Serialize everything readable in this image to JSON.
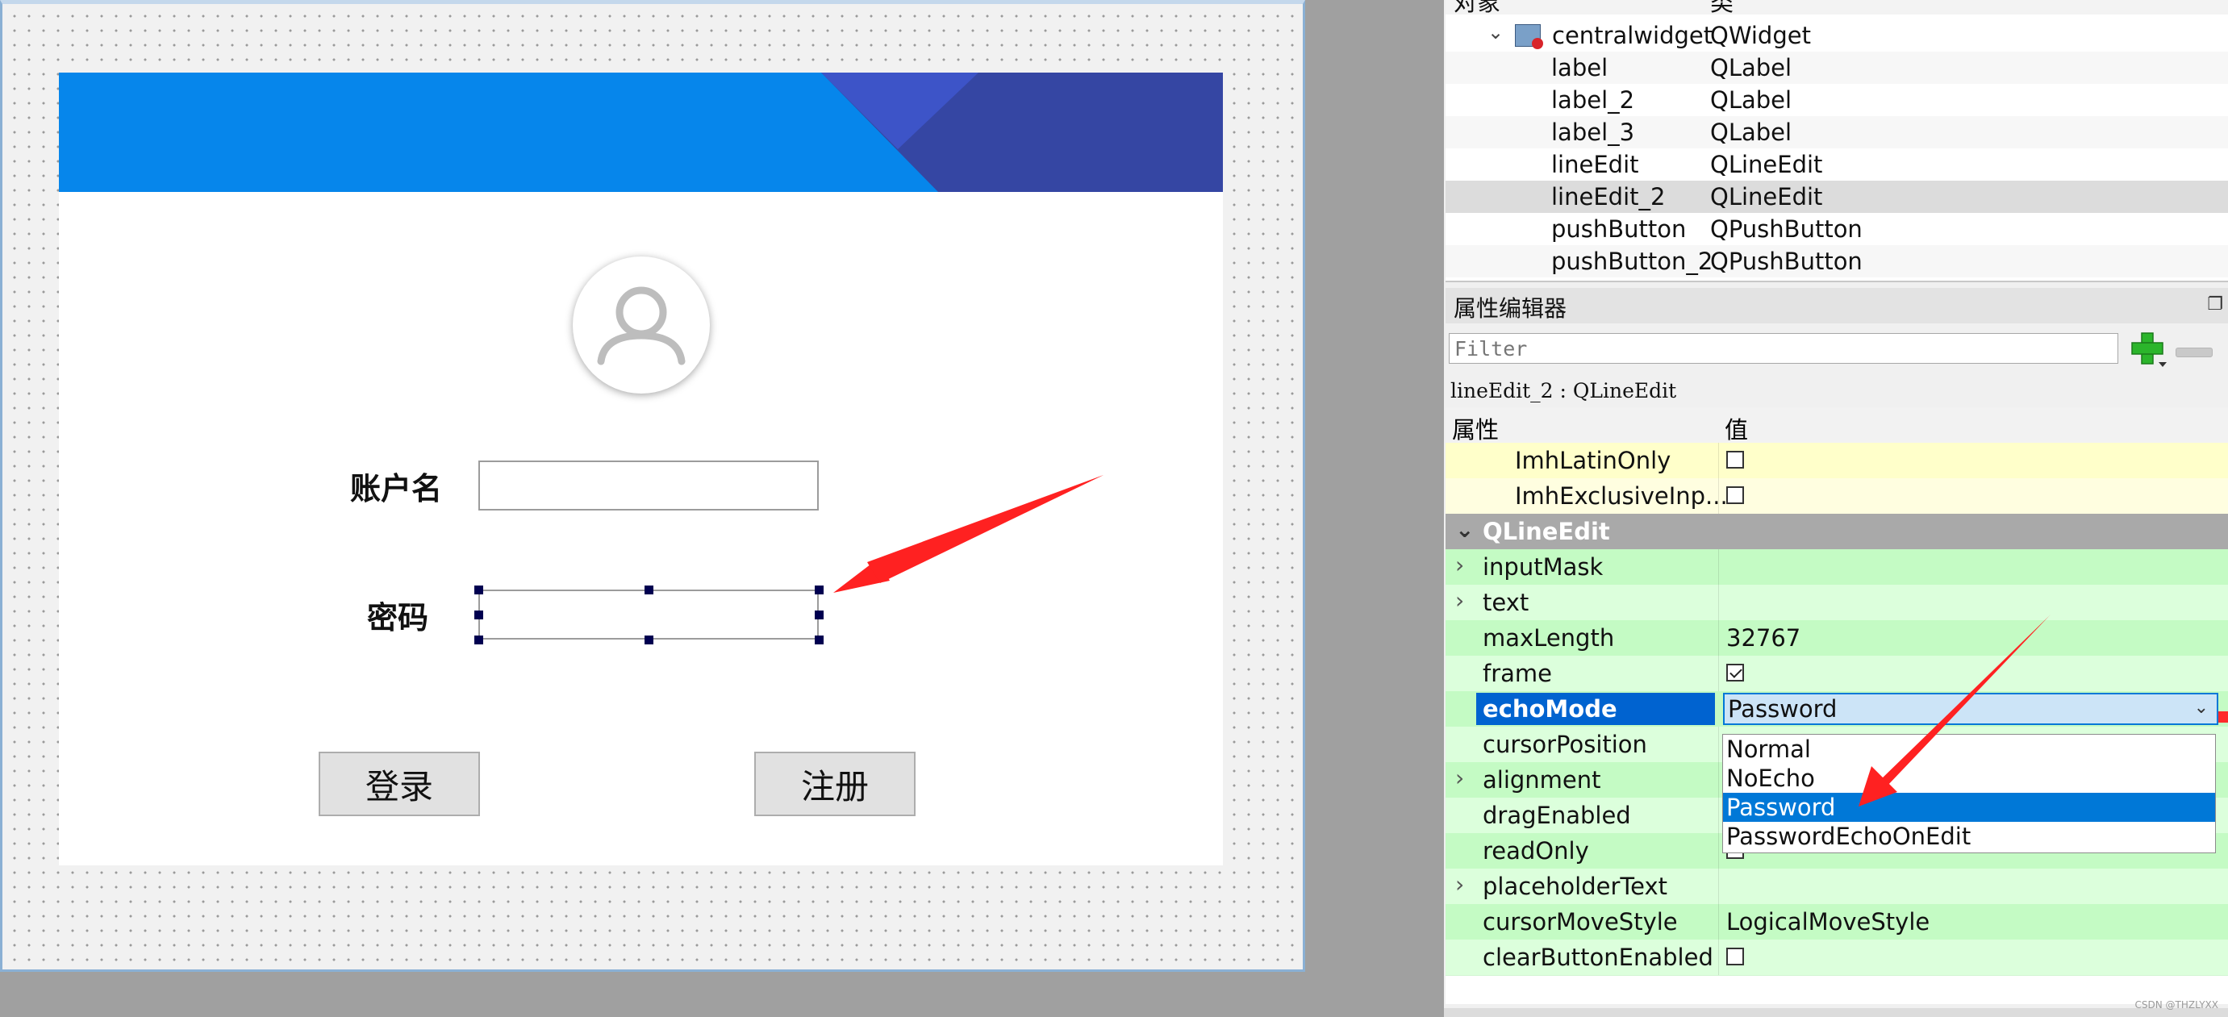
{
  "form": {
    "account_label": "账户名",
    "password_label": "密码",
    "login_button": "登录",
    "register_button": "注册"
  },
  "object_inspector": {
    "header_name": "对象",
    "header_class": "类",
    "rows": [
      {
        "name": "centralwidget",
        "cls": "QWidget"
      },
      {
        "name": "label",
        "cls": "QLabel"
      },
      {
        "name": "label_2",
        "cls": "QLabel"
      },
      {
        "name": "label_3",
        "cls": "QLabel"
      },
      {
        "name": "lineEdit",
        "cls": "QLineEdit"
      },
      {
        "name": "lineEdit_2",
        "cls": "QLineEdit"
      },
      {
        "name": "pushButton",
        "cls": "QPushButton"
      },
      {
        "name": "pushButton_2",
        "cls": "QPushButton"
      }
    ]
  },
  "property_editor": {
    "title": "属性编辑器",
    "filter_placeholder": "Filter",
    "object_name": "lineEdit_2 : QLineEdit",
    "col_property": "属性",
    "col_value": "值",
    "rows": [
      {
        "key": "ImhLatinOnly",
        "value": ""
      },
      {
        "key": "ImhExclusiveInp...",
        "value": ""
      },
      {
        "key": "QLineEdit",
        "value": ""
      },
      {
        "key": "inputMask",
        "value": ""
      },
      {
        "key": "text",
        "value": ""
      },
      {
        "key": "maxLength",
        "value": "32767"
      },
      {
        "key": "frame",
        "value": ""
      },
      {
        "key": "echoMode",
        "value": "Password"
      },
      {
        "key": "cursorPosition",
        "value": ""
      },
      {
        "key": "alignment",
        "value": ""
      },
      {
        "key": "dragEnabled",
        "value": ""
      },
      {
        "key": "readOnly",
        "value": ""
      },
      {
        "key": "placeholderText",
        "value": ""
      },
      {
        "key": "cursorMoveStyle",
        "value": "LogicalMoveStyle"
      },
      {
        "key": "clearButtonEnabled",
        "value": ""
      }
    ],
    "echo_options": [
      "Normal",
      "NoEcho",
      "Password",
      "PasswordEchoOnEdit"
    ],
    "echo_selected": "Password",
    "frame_checked": true
  },
  "watermark": "CSDN @THZLYXX",
  "colors": {
    "banner": "#0686eb",
    "banner_dark": "#3546a3",
    "selection": "#0078d7",
    "prop_green": "#c4fbc4",
    "prop_yellow": "#ffffca",
    "arrow": "#ff2121"
  }
}
